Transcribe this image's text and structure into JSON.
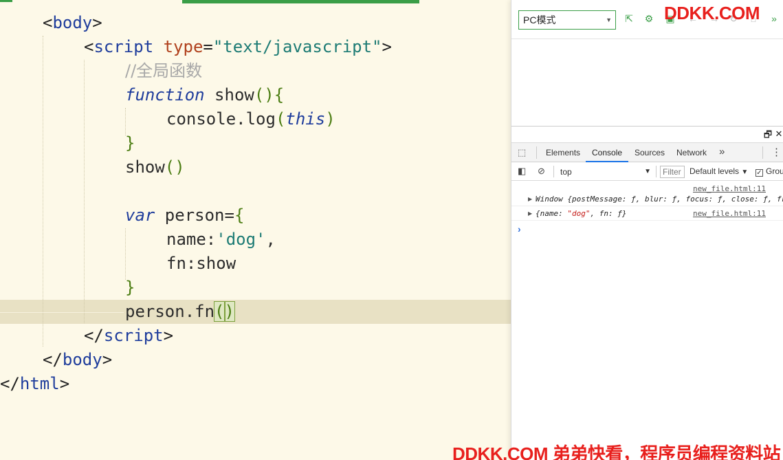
{
  "editor": {
    "lines": [
      [
        {
          "c": "tk-br",
          "t": "<"
        },
        {
          "c": "tk-tag",
          "t": "body"
        },
        {
          "c": "tk-br",
          "t": ">"
        }
      ],
      [
        {
          "c": "tk-br",
          "t": "<"
        },
        {
          "c": "tk-tag",
          "t": "script"
        },
        {
          "c": "tk-id",
          "t": " "
        },
        {
          "c": "tk-attr",
          "t": "type"
        },
        {
          "c": "tk-br",
          "t": "="
        },
        {
          "c": "tk-str",
          "t": "\"text/javascript\""
        },
        {
          "c": "tk-br",
          "t": ">"
        }
      ],
      [
        {
          "c": "tk-cm",
          "t": "//全局函数"
        }
      ],
      [
        {
          "c": "tk-kw",
          "t": "function"
        },
        {
          "c": "tk-id",
          "t": " show"
        },
        {
          "c": "tk-p",
          "t": "(){"
        }
      ],
      [
        {
          "c": "tk-id",
          "t": "console.log"
        },
        {
          "c": "tk-p",
          "t": "("
        },
        {
          "c": "tk-kw",
          "t": "this"
        },
        {
          "c": "tk-p",
          "t": ")"
        }
      ],
      [
        {
          "c": "tk-p",
          "t": "}"
        }
      ],
      [
        {
          "c": "tk-id",
          "t": "show"
        },
        {
          "c": "tk-p",
          "t": "()"
        }
      ],
      [],
      [
        {
          "c": "tk-kw",
          "t": "var"
        },
        {
          "c": "tk-id",
          "t": " person="
        },
        {
          "c": "tk-p",
          "t": "{"
        }
      ],
      [
        {
          "c": "tk-id",
          "t": "name:"
        },
        {
          "c": "tk-str",
          "t": "'dog'"
        },
        {
          "c": "tk-id",
          "t": ","
        }
      ],
      [
        {
          "c": "tk-id",
          "t": "fn:show"
        }
      ],
      [
        {
          "c": "tk-p",
          "t": "}"
        }
      ],
      [
        {
          "c": "tk-id",
          "t": "person.fn"
        },
        {
          "c": "tk-bm",
          "t": "("
        },
        {
          "c": "tk-bm",
          "t": ")"
        }
      ],
      [
        {
          "c": "tk-br",
          "t": "</"
        },
        {
          "c": "tk-tag",
          "t": "script"
        },
        {
          "c": "tk-br",
          "t": ">"
        }
      ],
      [
        {
          "c": "tk-br",
          "t": "</"
        },
        {
          "c": "tk-tag",
          "t": "body"
        },
        {
          "c": "tk-br",
          "t": ">"
        }
      ],
      [
        {
          "c": "tk-br",
          "t": "</"
        },
        {
          "c": "tk-tag",
          "t": "html"
        },
        {
          "c": "tk-br",
          "t": ">"
        }
      ]
    ]
  },
  "preview_toolbar": {
    "mode_label": "PC模式",
    "brand": "DDKK.COM",
    "icons": [
      "open-external-icon",
      "settings-icon",
      "screenshot-icon",
      "back-icon",
      "forward-icon",
      "refresh-icon",
      "home-icon",
      "expand-icon"
    ]
  },
  "devtools": {
    "window_buttons": {
      "restore": "🗗",
      "close": "✕"
    },
    "tabs": [
      {
        "label": "Elements",
        "active": false
      },
      {
        "label": "Console",
        "active": true
      },
      {
        "label": "Sources",
        "active": false
      },
      {
        "label": "Network",
        "active": false
      }
    ],
    "more_tabs": "»",
    "menu": "⋮",
    "console_bar": {
      "context": "top",
      "filter_placeholder": "Filter",
      "levels": "Default levels",
      "group_label": "Grou",
      "group_checked": true
    },
    "log": [
      {
        "source": "new_file.html:11",
        "message": "Window {postMessage: ƒ, blur: ƒ, focus: ƒ, close: ƒ, fr"
      },
      {
        "source": "new_file.html:11",
        "message_pre": "{name: ",
        "message_str": "\"dog\"",
        "message_post": ", fn: ƒ}"
      }
    ],
    "prompt": "›"
  },
  "watermark": "DDKK.COM 弟弟快看，程序员编程资料站"
}
